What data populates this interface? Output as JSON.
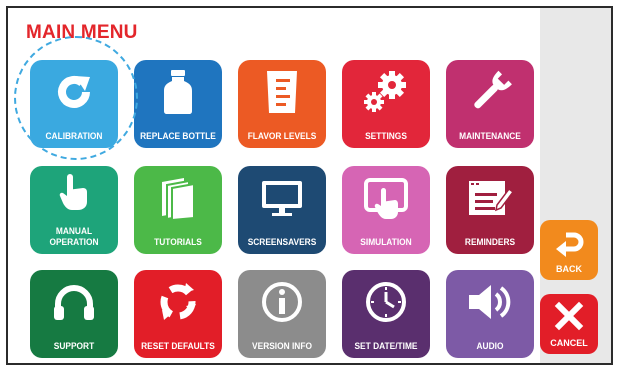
{
  "title": "MAIN MENU",
  "tiles": [
    {
      "label": "CALIBRATION",
      "icon": "refresh-icon",
      "color": "#3aa9e0"
    },
    {
      "label": "REPLACE BOTTLE",
      "icon": "bottle-icon",
      "color": "#1f75bf"
    },
    {
      "label": "FLAVOR LEVELS",
      "icon": "beaker-icon",
      "color": "#ec5a24"
    },
    {
      "label": "SETTINGS",
      "icon": "gear-icon",
      "color": "#e2263a"
    },
    {
      "label": "MAINTENANCE",
      "icon": "wrench-icon",
      "color": "#c0306f"
    },
    {
      "label": "MANUAL OPERATION",
      "icon": "hand-pointer-icon",
      "color": "#1ea47a"
    },
    {
      "label": "TUTORIALS",
      "icon": "book-icon",
      "color": "#4cb948"
    },
    {
      "label": "SCREENSAVERS",
      "icon": "monitor-icon",
      "color": "#1e4a73"
    },
    {
      "label": "SIMULATION",
      "icon": "tablet-touch-icon",
      "color": "#d665b4"
    },
    {
      "label": "REMINDERS",
      "icon": "notepad-icon",
      "color": "#a01f3f"
    },
    {
      "label": "SUPPORT",
      "icon": "headphones-icon",
      "color": "#167a42"
    },
    {
      "label": "RESET DEFAULTS",
      "icon": "reset-arrows-icon",
      "color": "#e21e28"
    },
    {
      "label": "VERSION INFO",
      "icon": "info-icon",
      "color": "#8c8c8c"
    },
    {
      "label": "SET DATE/TIME",
      "icon": "clock-icon",
      "color": "#5a2f6e"
    },
    {
      "label": "AUDIO",
      "icon": "speaker-icon",
      "color": "#7d5aa6"
    }
  ],
  "sidebar": {
    "back": {
      "label": "BACK",
      "icon": "return-arrow-icon",
      "color": "#f28a1d"
    },
    "cancel": {
      "label": "CANCEL",
      "icon": "close-icon",
      "color": "#e21e28"
    }
  }
}
